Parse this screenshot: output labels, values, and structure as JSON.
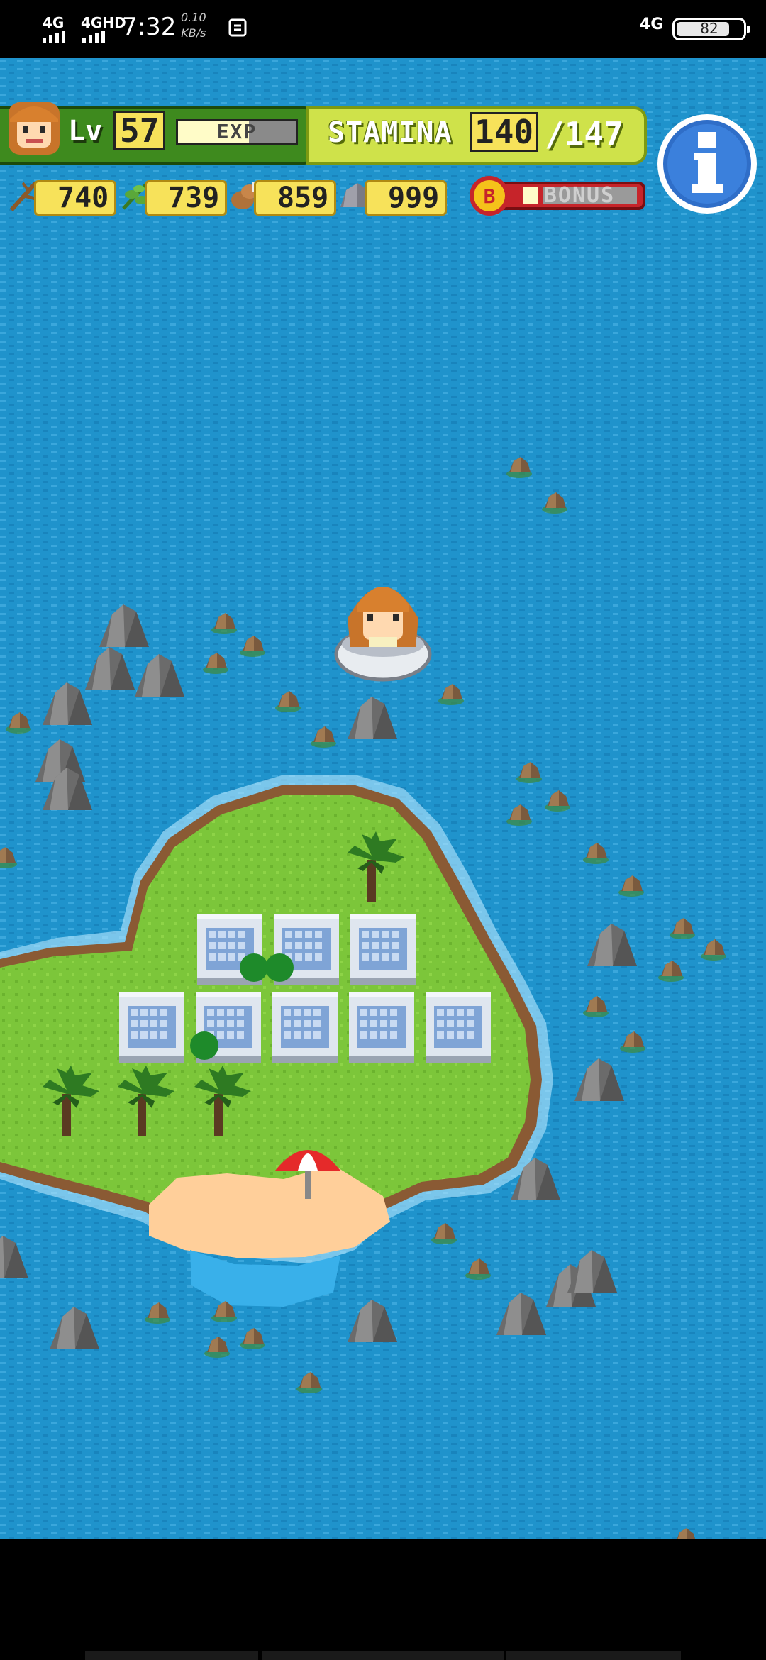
{
  "status_bar": {
    "network_left_1": "4G",
    "network_left_2": "4GHD",
    "time": "7:32",
    "speed_value": "0.10",
    "speed_unit": "KB/s",
    "network_right": "4G",
    "battery_level": "82",
    "battery_fraction": 0.82
  },
  "hud": {
    "level_label": "Lv",
    "level_value": "57",
    "exp_label": "EXP",
    "exp_fraction": 0.6,
    "stamina_label": "STAMINA",
    "stamina_current": "140",
    "stamina_max": "/147",
    "info_icon": "info-icon",
    "resources": [
      {
        "icon": "branch-icon",
        "value": "740"
      },
      {
        "icon": "herb-icon",
        "value": "739"
      },
      {
        "icon": "food-icon",
        "value": "859"
      },
      {
        "icon": "stone-icon",
        "value": "999"
      }
    ],
    "bonus_label": "BONUS",
    "bonus_coin_letter": "B",
    "bonus_fraction": 0.1
  },
  "colors": {
    "ocean": "#1f93cc",
    "grass": "#7cc63a",
    "sand": "#ffcf9a",
    "hud_green": "#3e8a1e",
    "hud_yellow_green": "#cfe24a",
    "bonus_red": "#c6242a"
  }
}
